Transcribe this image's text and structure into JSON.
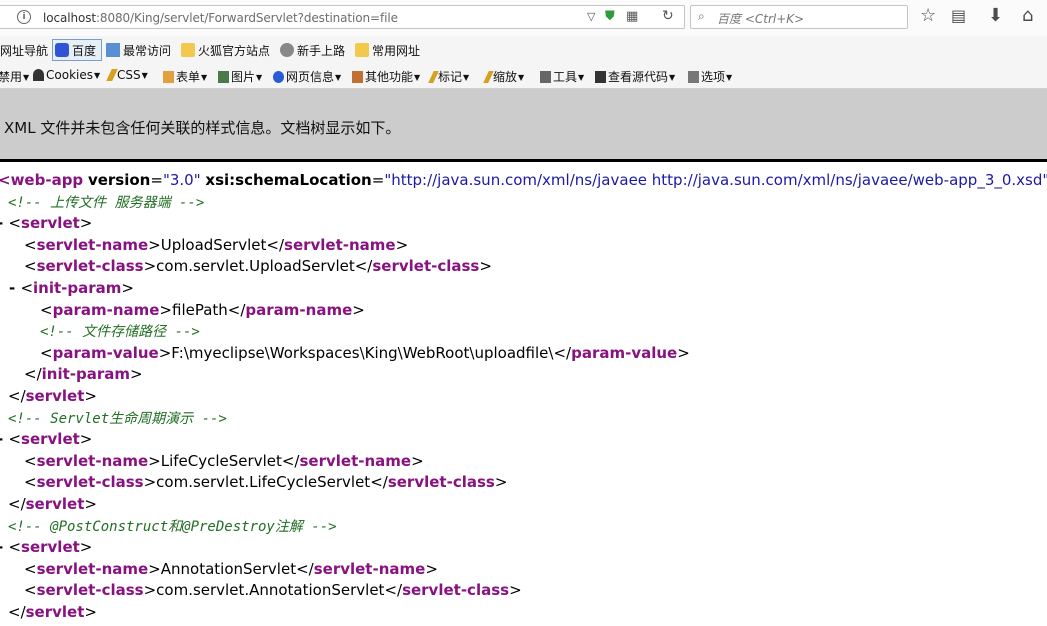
{
  "browser": {
    "url": {
      "host": "localhost",
      "rest": ":8080/King/servlet/ForwardServlet?destination=file"
    },
    "search_placeholder": "百度 <Ctrl+K>"
  },
  "bookmarks": [
    "网址导航",
    "百度",
    "最常访问",
    "火狐官方站点",
    "新手上路",
    "常用网址"
  ],
  "webdev_toolbar": [
    "禁用",
    "Cookies",
    "CSS",
    "表单",
    "图片",
    "网页信息",
    "其他功能",
    "标记",
    "缩放",
    "工具",
    "查看源代码",
    "选项"
  ],
  "banner": "XML 文件并未包含任何关联的样式信息。文档树显示如下。",
  "xml": {
    "root": {
      "tag": "web-app",
      "attr1": "version",
      "val1": "3.0",
      "attr2": "xsi:schemaLocation",
      "val2": "http://java.sun.com/xml/ns/javaee http://java.sun.com/xml/ns/javaee/web-app_3_0.xsd"
    },
    "comment1": "<!-- 上传文件 服务器端 -->",
    "servlet_tag": "servlet",
    "servlet_name_tag": "servlet-name",
    "servlet_class_tag": "servlet-class",
    "init_param_tag": "init-param",
    "param_name_tag": "param-name",
    "param_value_tag": "param-value",
    "s1": {
      "name": "UploadServlet",
      "class": "com.servlet.UploadServlet"
    },
    "param_name": "filePath",
    "comment_param": "<!-- 文件存储路径 -->",
    "param_value": "F:\\myeclipse\\Workspaces\\King\\WebRoot\\uploadfile\\",
    "comment2": "<!-- Servlet生命周期演示 -->",
    "s2": {
      "name": "LifeCycleServlet",
      "class": "com.servlet.LifeCycleServlet"
    },
    "comment3": "<!-- @PostConstruct和@PreDestroy注解 -->",
    "s3": {
      "name": "AnnotationServlet",
      "class": "com.servlet.AnnotationServlet"
    }
  }
}
